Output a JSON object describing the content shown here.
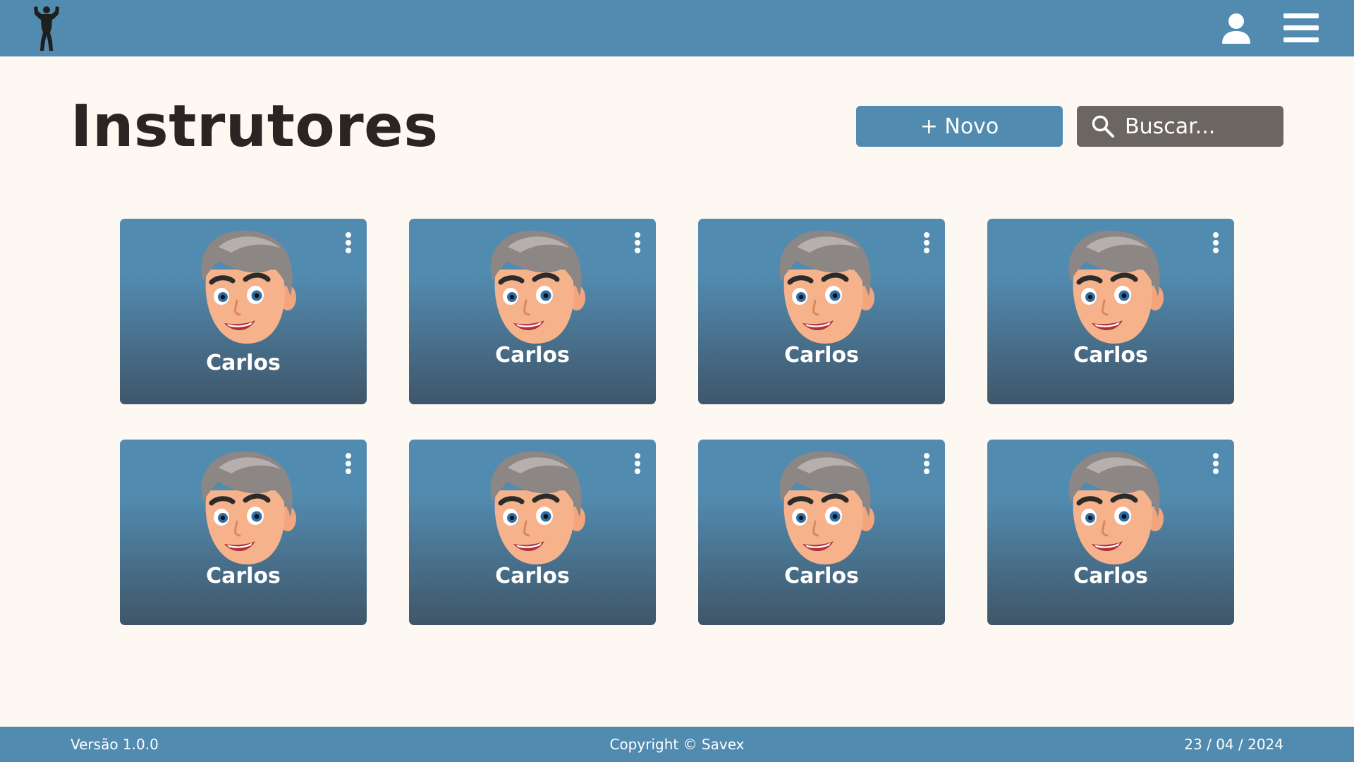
{
  "header": {
    "logo_icon": "bodybuilder-silhouette-icon",
    "user_icon": "user-icon",
    "menu_icon": "hamburger-menu-icon"
  },
  "main": {
    "title": "Instrutores",
    "new_button_label": "+ Novo",
    "search_placeholder": "Buscar...",
    "instructors": [
      {
        "name": "Carlos"
      },
      {
        "name": "Carlos"
      },
      {
        "name": "Carlos"
      },
      {
        "name": "Carlos"
      },
      {
        "name": "Carlos"
      },
      {
        "name": "Carlos"
      },
      {
        "name": "Carlos"
      },
      {
        "name": "Carlos"
      }
    ]
  },
  "footer": {
    "version": "Versão 1.0.0",
    "copyright": "Copyright © Savex",
    "date": "23 / 04 / 2024"
  },
  "colors": {
    "primary": "#528bb0",
    "background": "#fdf8f2",
    "search_background": "#6c6663",
    "title_text": "#2a2522"
  }
}
